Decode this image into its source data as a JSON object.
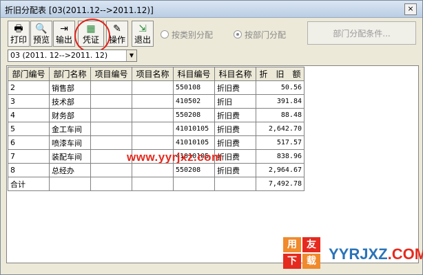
{
  "window": {
    "title": "折旧分配表 [03(2011.12-->2011.12)]",
    "close_label": "×"
  },
  "toolbar": {
    "print": "打印",
    "preview": "预览",
    "export": "输出",
    "voucher": "凭证",
    "operate": "操作",
    "exit": "退出"
  },
  "radios": {
    "by_category": "按类别分配",
    "by_department": "按部门分配",
    "selected": "by_department"
  },
  "cond_button": "部门分配条件...",
  "period_select": {
    "value": "03 (2011. 12-->2011. 12)"
  },
  "table": {
    "headers": [
      "部门编号",
      "部门名称",
      "项目编号",
      "项目名称",
      "科目编号",
      "科目名称",
      "折　旧　额"
    ],
    "rows": [
      [
        "2",
        "销售部",
        "",
        "",
        "550108",
        "折旧费",
        "50.56"
      ],
      [
        "3",
        "技术部",
        "",
        "",
        "410502",
        "折旧",
        "391.84"
      ],
      [
        "4",
        "财务部",
        "",
        "",
        "550208",
        "折旧费",
        "88.48"
      ],
      [
        "5",
        "金工车间",
        "",
        "",
        "41010105",
        "折旧费",
        "2,642.70"
      ],
      [
        "6",
        "喷漆车间",
        "",
        "",
        "41010105",
        "折旧费",
        "517.57"
      ],
      [
        "7",
        "装配车间",
        "",
        "",
        "41010105",
        "折旧费",
        "838.96"
      ],
      [
        "8",
        "总经办",
        "",
        "",
        "550208",
        "折旧费",
        "2,964.67"
      ]
    ],
    "total_label": "合计",
    "total_value": "7,492.78"
  },
  "watermark": {
    "center": "www.yyrjxz.com",
    "box1": "用",
    "box2": "友",
    "box3": "下",
    "box4": "载",
    "site": "YYRJXZ",
    "site_suffix": ".COM"
  },
  "colors": {
    "highlight_circle": "#e0201a",
    "watermark": "#e52a1f"
  }
}
